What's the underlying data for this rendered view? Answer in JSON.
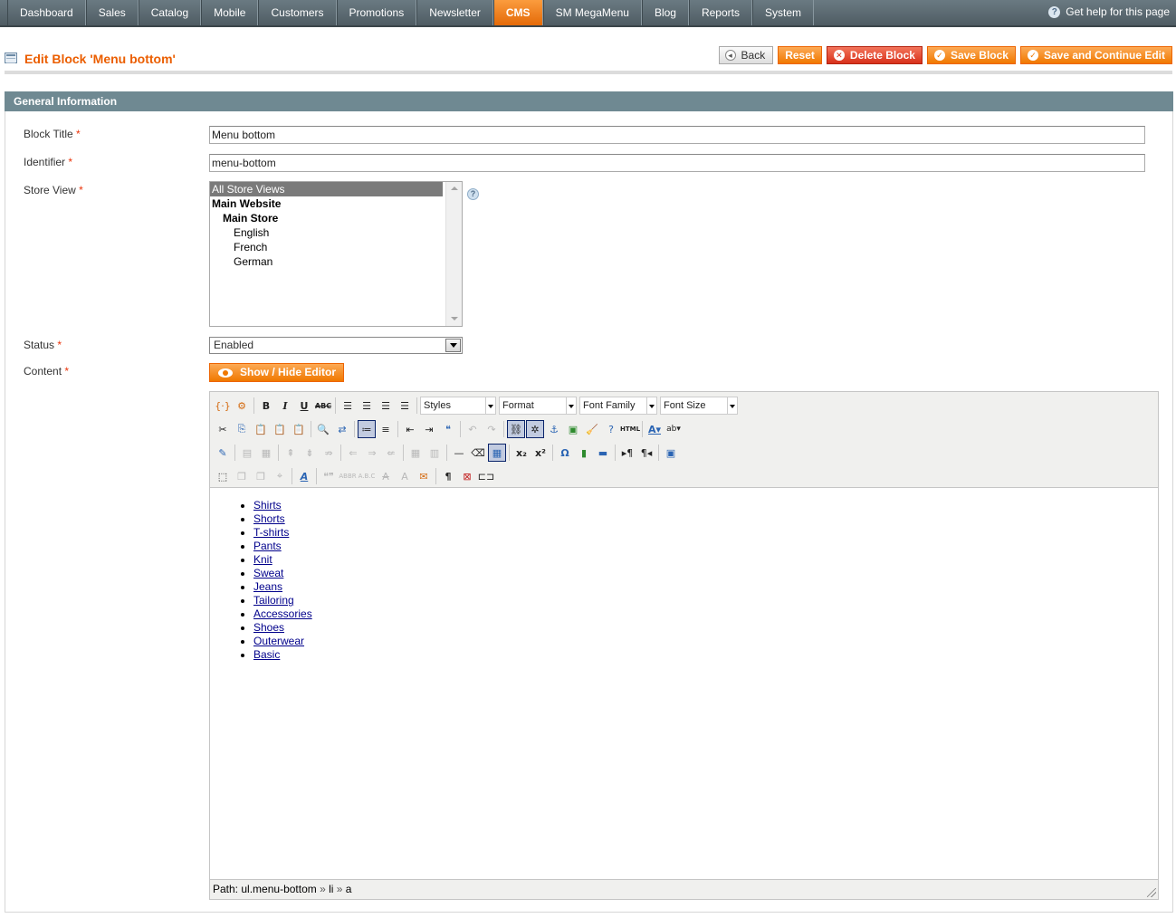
{
  "nav": {
    "items": [
      "Dashboard",
      "Sales",
      "Catalog",
      "Mobile",
      "Customers",
      "Promotions",
      "Newsletter",
      "CMS",
      "SM MegaMenu",
      "Blog",
      "Reports",
      "System"
    ],
    "active": "CMS",
    "help_label": "Get help for this page"
  },
  "page": {
    "title": "Edit Block 'Menu bottom'",
    "buttons": {
      "back": "Back",
      "reset": "Reset",
      "delete": "Delete Block",
      "save": "Save Block",
      "save_continue": "Save and Continue Edit"
    }
  },
  "section": {
    "title": "General Information"
  },
  "form": {
    "block_title": {
      "label": "Block Title",
      "value": "Menu bottom"
    },
    "identifier": {
      "label": "Identifier",
      "value": "menu-bottom"
    },
    "store_view": {
      "label": "Store View",
      "options": [
        {
          "text": "All Store Views",
          "selected": true,
          "level": 0,
          "group": false
        },
        {
          "text": "Main Website",
          "selected": false,
          "level": 0,
          "group": true
        },
        {
          "text": "Main Store",
          "selected": false,
          "level": 1,
          "group": true
        },
        {
          "text": "English",
          "selected": false,
          "level": 2,
          "group": false
        },
        {
          "text": "French",
          "selected": false,
          "level": 2,
          "group": false
        },
        {
          "text": "German",
          "selected": false,
          "level": 2,
          "group": false
        }
      ]
    },
    "status": {
      "label": "Status",
      "value": "Enabled"
    },
    "content": {
      "label": "Content",
      "toggle_label": "Show / Hide Editor"
    },
    "required_mark": "*"
  },
  "editor": {
    "dropdowns": {
      "styles": "Styles",
      "format": "Format",
      "font_family": "Font Family",
      "font_size": "Font Size"
    },
    "links": [
      "Shirts",
      "Shorts",
      "T-shirts",
      "Pants",
      "Knit",
      "Sweat",
      "Jeans",
      "Tailoring",
      "Accessories",
      "Shoes",
      "Outerwear",
      "Basic"
    ],
    "path": {
      "prefix": "Path:",
      "parts": [
        "ul.menu-bottom",
        "li",
        "a"
      ],
      "separator": "»"
    }
  },
  "colors": {
    "accent": "#eb5e00",
    "nav_bg": "#5b6a71",
    "section_head": "#6f8992",
    "link": "#00008b"
  }
}
